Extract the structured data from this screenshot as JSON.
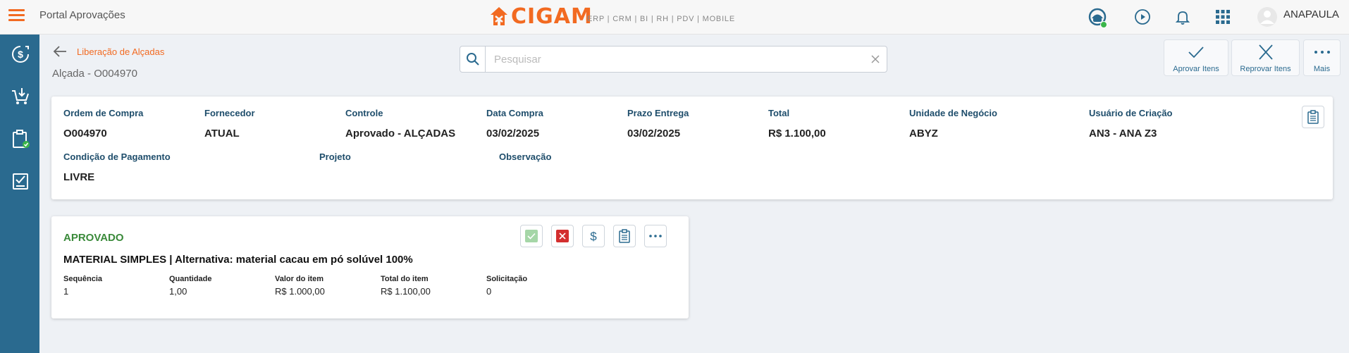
{
  "app": {
    "title": "Portal Aprovações",
    "logo_text": "CIGAM",
    "modules": "ERP | CRM | BI | RH | PDV | MOBILE",
    "user": "ANAPAULA"
  },
  "colors": {
    "brand_orange": "#f26a21",
    "sidebar_blue": "#2a6a8f",
    "label_blue": "#1e4d6b",
    "approved_green": "#3a8a3a",
    "reject_red": "#d32f2f"
  },
  "icons": {
    "menu": "hamburger-icon",
    "top": [
      "support-icon",
      "play-circle-icon",
      "bell-icon",
      "apps-grid-icon",
      "user-avatar-icon"
    ],
    "sidebar": [
      "dollar-circle-icon",
      "cart-download-icon",
      "clipboard-check-icon",
      "checklist-icon"
    ]
  },
  "header": {
    "breadcrumb": "Liberação de Alçadas",
    "title": "Alçada - O004970",
    "search": {
      "placeholder": "Pesquisar",
      "value": ""
    },
    "actions": [
      {
        "label": "Aprovar Itens",
        "icon": "check-icon"
      },
      {
        "label": "Reprovar Itens",
        "icon": "close-icon"
      },
      {
        "label": "Mais",
        "icon": "more-horizontal-icon"
      }
    ]
  },
  "order": {
    "fields": [
      {
        "label": "Ordem de Compra",
        "value": "O004970"
      },
      {
        "label": "Fornecedor",
        "value": "ATUAL"
      },
      {
        "label": "Controle",
        "value": "Aprovado - ALÇADAS"
      },
      {
        "label": "Data Compra",
        "value": "03/02/2025"
      },
      {
        "label": "Prazo Entrega",
        "value": "03/02/2025"
      },
      {
        "label": "Total",
        "value": "R$ 1.100,00"
      },
      {
        "label": "Unidade de Negócio",
        "value": "ABYZ"
      },
      {
        "label": "Usuário de Criação",
        "value": "AN3 - ANA Z3"
      },
      {
        "label": "Condição de Pagamento",
        "value": "LIVRE"
      },
      {
        "label": "Projeto",
        "value": ""
      },
      {
        "label": "Observação",
        "value": ""
      }
    ]
  },
  "item": {
    "status": "APROVADO",
    "title": "MATERIAL SIMPLES | Alternativa: material cacau em pó solúvel 100%",
    "fields": [
      {
        "label": "Sequência",
        "value": "1"
      },
      {
        "label": "Quantidade",
        "value": "1,00"
      },
      {
        "label": "Valor do item",
        "value": "R$ 1.000,00"
      },
      {
        "label": "Total do item",
        "value": "R$ 1.100,00"
      },
      {
        "label": "Solicitação",
        "value": "0"
      }
    ],
    "actions": [
      "approve-item-icon",
      "reject-item-icon",
      "dollar-icon",
      "clipboard-icon",
      "more-horizontal-icon"
    ]
  }
}
